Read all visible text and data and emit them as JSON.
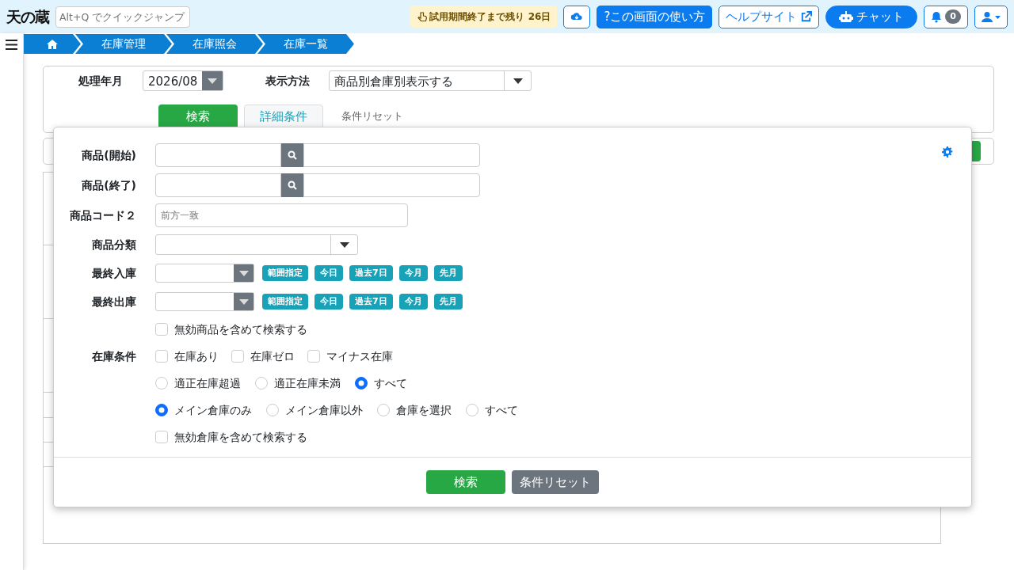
{
  "header": {
    "logo": "天の蔵",
    "quick_jump": {
      "placeholder": "Alt+Q でクイックジャンプ"
    },
    "trial_notice": "試用期間終了まで残り 26日",
    "help_button": "?この画面の使い方",
    "help_site": "ヘルプサイト",
    "chat": "チャット",
    "notifications": "0"
  },
  "breadcrumb": [
    "在庫管理",
    "在庫照会",
    "在庫一覧"
  ],
  "filter": {
    "month_label": "処理年月",
    "month_value": "2026/08",
    "display_label": "表示方法",
    "display_value": "商品別倉庫別表示する",
    "tabs": [
      {
        "label": "検索",
        "kind": "search"
      },
      {
        "label": "詳細条件",
        "kind": "detail",
        "selected": true
      },
      {
        "label": "条件リセット",
        "kind": "reset"
      }
    ]
  },
  "detail_panel": {
    "fields": [
      {
        "kind": "lookup",
        "label": "商品(開始)"
      },
      {
        "kind": "lookup",
        "label": "商品(終了)"
      },
      {
        "kind": "text",
        "label": "商品コード２",
        "placeholder": "前方一致"
      },
      {
        "kind": "select",
        "label": "商品分類"
      },
      {
        "kind": "date",
        "label": "最終入庫",
        "quick": [
          "範囲指定",
          "今日",
          "過去7日",
          "今月",
          "先月"
        ]
      },
      {
        "kind": "date",
        "label": "最終出庫",
        "quick": [
          "範囲指定",
          "今日",
          "過去7日",
          "今月",
          "先月"
        ]
      },
      {
        "kind": "checks",
        "options": [
          {
            "label": "無効商品を含めて検索する",
            "checked": false
          }
        ]
      },
      {
        "kind": "checks",
        "label": "在庫条件",
        "options": [
          {
            "label": "在庫あり",
            "checked": false
          },
          {
            "label": "在庫ゼロ",
            "checked": false
          },
          {
            "label": "マイナス在庫",
            "checked": false
          }
        ]
      },
      {
        "kind": "radios",
        "options": [
          {
            "label": "適正在庫超過",
            "selected": false
          },
          {
            "label": "適正在庫未満",
            "selected": false
          },
          {
            "label": "すべて",
            "selected": true
          }
        ]
      },
      {
        "kind": "radios",
        "options": [
          {
            "label": "メイン倉庫のみ",
            "selected": true
          },
          {
            "label": "メイン倉庫以外",
            "selected": false
          },
          {
            "label": "倉庫を選択",
            "selected": false
          },
          {
            "label": "すべて",
            "selected": false
          }
        ]
      },
      {
        "kind": "checks",
        "options": [
          {
            "label": "無効倉庫を含めて検索する",
            "checked": false
          }
        ]
      }
    ],
    "buttons": [
      {
        "label": "検索",
        "kind": "search"
      },
      {
        "label": "条件リセット",
        "kind": "reset"
      }
    ]
  }
}
